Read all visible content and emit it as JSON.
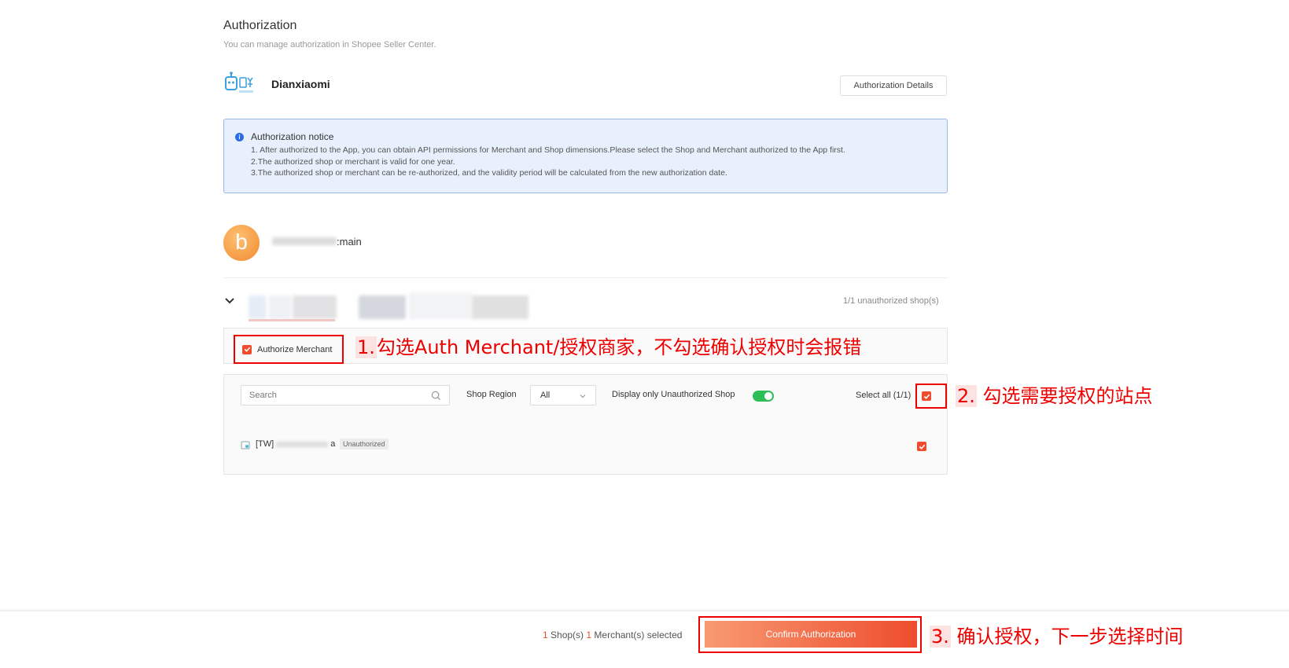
{
  "header": {
    "title": "Authorization",
    "subtitle": "You can manage authorization in Shopee Seller Center."
  },
  "app": {
    "logo_icon": "dianxiaomi-robot-logo",
    "name": "Dianxiaomi",
    "details_button": "Authorization Details"
  },
  "notice": {
    "icon": "info-icon",
    "title": "Authorization notice",
    "lines": [
      "1. After authorized to the App, you can obtain API permissions for Merchant and Shop dimensions.Please select the Shop and Merchant authorized to the App first.",
      "2.The authorized shop or merchant is valid for one year.",
      "3.The authorized shop or merchant can be re-authorized, and the validity period will be calculated from the new authorization date."
    ]
  },
  "account": {
    "avatar_letter": "b",
    "name_suffix": ":main"
  },
  "merchant_group": {
    "unauthorized_count": "1/1 unauthorized shop(s)",
    "authorize_merchant_label": "Authorize Merchant",
    "authorize_merchant_checked": true
  },
  "filters": {
    "search_placeholder": "Search",
    "region_label": "Shop Region",
    "region_value": "All",
    "display_only_label": "Display only Unauthorized Shop",
    "display_only_on": true,
    "select_all_label": "Select all (1/1)",
    "select_all_checked": true
  },
  "shops": [
    {
      "name_prefix": "[TW]",
      "name_suffix": "a",
      "status": "Unauthorized",
      "checked": true
    }
  ],
  "footer": {
    "shop_count": "1",
    "shop_text": " Shop(s) ",
    "merchant_count": "1",
    "merchant_text": " Merchant(s) selected",
    "confirm_button": "Confirm Authorization"
  },
  "annotations": {
    "step1_num": "1.",
    "step1_text": "勾选Auth Merchant/授权商家，不勾选确认授权时会报错",
    "step2_num": "2.",
    "step2_text": "勾选需要授权的站点",
    "step3_num": "3.",
    "step3_text": "确认授权，下一步选择时间"
  },
  "colors": {
    "brand": "#ee4d2d",
    "annotation": "#ee0000",
    "notice_bg": "#e8f0fd",
    "toggle_on": "#2cbe57"
  }
}
